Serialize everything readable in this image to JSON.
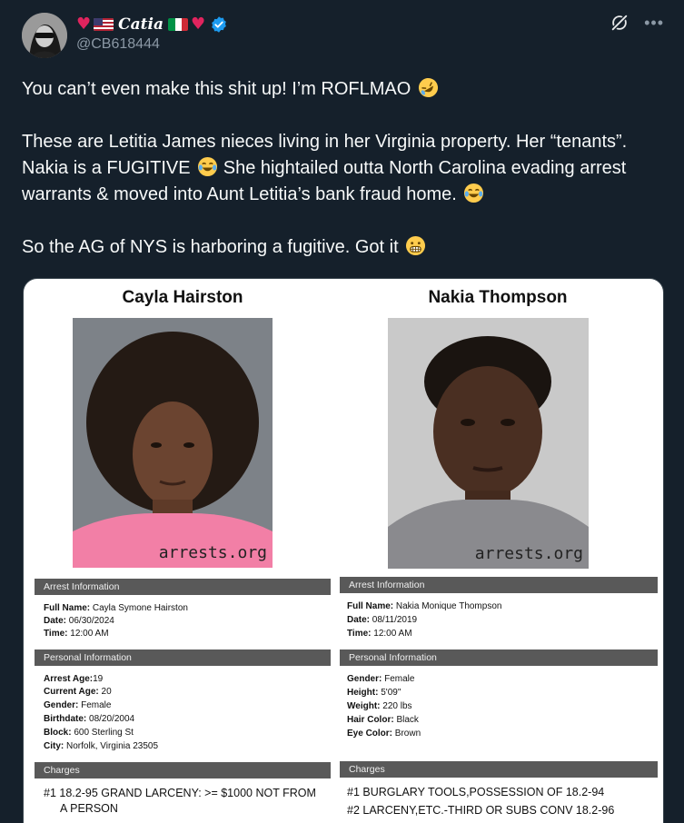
{
  "tweet": {
    "author": {
      "display_name": "Catia",
      "handle": "@CB618444",
      "verified": true,
      "name_decorations": [
        "heart",
        "us-flag",
        "italy-flag",
        "heart"
      ]
    },
    "paragraphs": [
      {
        "text": "You can’t even make this shit up! I’m ROFLMAO",
        "emoji": "rolling-on-floor-laughing"
      },
      {
        "text": "These are Letitia James nieces living in her Virginia property. Her “tenants”. Nakia is a FUGITIVE",
        "emoji": "tears-of-joy",
        "text2": "She hightailed outta North Carolina evading arrest warrants & moved into Aunt Letitia’s bank fraud home.",
        "emoji2": "tears-of-joy"
      },
      {
        "text": "So the AG of NYS is harboring a fugitive. Got it",
        "emoji": "grimacing-face"
      }
    ]
  },
  "media": {
    "left": {
      "name": "Cayla Hairston",
      "watermark": "arrests.org",
      "arrest_header": "Arrest Information",
      "arrest": [
        {
          "label": "Full Name:",
          "value": " Cayla Symone Hairston"
        },
        {
          "label": "Date:",
          "value": " 06/30/2024"
        },
        {
          "label": "Time:",
          "value": " 12:00 AM"
        }
      ],
      "personal_header": "Personal Information",
      "personal": [
        {
          "label": "Arrest Age:",
          "value": "19"
        },
        {
          "label": "Current Age:",
          "value": " 20"
        },
        {
          "label": "Gender:",
          "value": " Female"
        },
        {
          "label": "Birthdate:",
          "value": " 08/20/2004"
        },
        {
          "label": "Block:",
          "value": " 600 Sterling St"
        },
        {
          "label": "City:",
          "value": " Norfolk, Virginia 23505"
        }
      ],
      "charges_header": "Charges",
      "charges": [
        "#1 18.2-95 GRAND LARCENY: >= $1000 NOT FROM",
        "A PERSON"
      ]
    },
    "right": {
      "name": "Nakia Thompson",
      "watermark": "arrests.org",
      "arrest_header": "Arrest Information",
      "arrest": [
        {
          "label": "Full Name:",
          "value": " Nakia Monique Thompson"
        },
        {
          "label": "Date:",
          "value": " 08/11/2019"
        },
        {
          "label": "Time:",
          "value": " 12:00 AM"
        }
      ],
      "personal_header": "Personal Information",
      "personal": [
        {
          "label": "Gender:",
          "value": " Female"
        },
        {
          "label": "Height:",
          "value": " 5'09\""
        },
        {
          "label": "Weight:",
          "value": " 220 lbs"
        },
        {
          "label": "Hair Color:",
          "value": " Black"
        },
        {
          "label": "Eye Color:",
          "value": " Brown"
        }
      ],
      "charges_header": "Charges",
      "charges": [
        "#1 BURGLARY TOOLS,POSSESSION OF 18.2-94",
        "#2 LARCENY,ETC.-THIRD OR SUBS CONV 18.2-96"
      ]
    }
  },
  "colors": {
    "background": "#15202b",
    "text": "#f7f9f9",
    "muted": "#8b98a5",
    "verified": "#1d9bf0",
    "heart": "#e0245e",
    "section_bar": "#595959"
  }
}
